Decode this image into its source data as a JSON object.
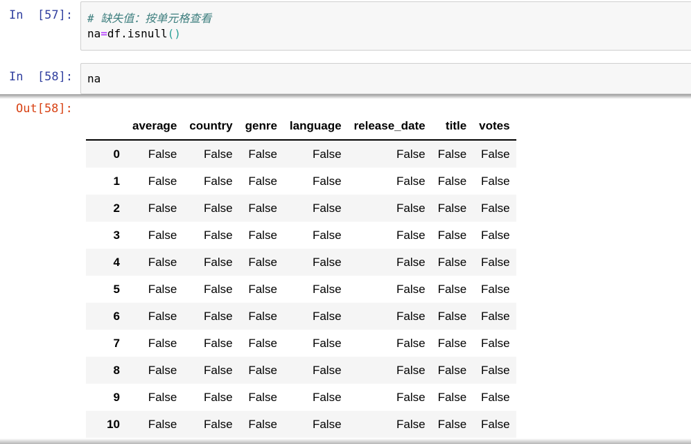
{
  "cells": [
    {
      "prompt": "In  [57]:",
      "code_line1": "# 缺失值：按单元格查看",
      "code_line2_a": "na",
      "code_line2_op": "=",
      "code_line2_b": "df.isnull",
      "code_line2_paren": "()"
    },
    {
      "prompt": "In  [58]:",
      "code_line1": "na"
    }
  ],
  "output": {
    "prompt": "Out[58]:",
    "columns": [
      "",
      "average",
      "country",
      "genre",
      "language",
      "release_date",
      "title",
      "votes"
    ],
    "rows": [
      [
        "0",
        "False",
        "False",
        "False",
        "False",
        "False",
        "False",
        "False"
      ],
      [
        "1",
        "False",
        "False",
        "False",
        "False",
        "False",
        "False",
        "False"
      ],
      [
        "2",
        "False",
        "False",
        "False",
        "False",
        "False",
        "False",
        "False"
      ],
      [
        "3",
        "False",
        "False",
        "False",
        "False",
        "False",
        "False",
        "False"
      ],
      [
        "4",
        "False",
        "False",
        "False",
        "False",
        "False",
        "False",
        "False"
      ],
      [
        "5",
        "False",
        "False",
        "False",
        "False",
        "False",
        "False",
        "False"
      ],
      [
        "6",
        "False",
        "False",
        "False",
        "False",
        "False",
        "False",
        "False"
      ],
      [
        "7",
        "False",
        "False",
        "False",
        "False",
        "False",
        "False",
        "False"
      ],
      [
        "8",
        "False",
        "False",
        "False",
        "False",
        "False",
        "False",
        "False"
      ],
      [
        "9",
        "False",
        "False",
        "False",
        "False",
        "False",
        "False",
        "False"
      ],
      [
        "10",
        "False",
        "False",
        "False",
        "False",
        "False",
        "False",
        "False"
      ]
    ]
  }
}
